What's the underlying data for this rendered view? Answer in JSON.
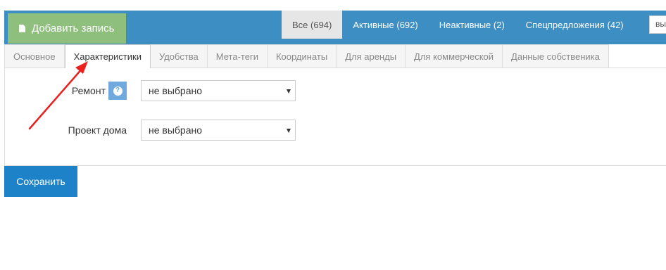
{
  "toolbar": {
    "add_label": "Добавить запись",
    "add_icon": "file-icon",
    "filters": [
      {
        "label": "Все (694)",
        "active": true
      },
      {
        "label": "Активные (692)",
        "active": false
      },
      {
        "label": "Неактивные (2)",
        "active": false
      },
      {
        "label": "Спецпредложения (42)",
        "active": false
      }
    ],
    "search_value": "вы"
  },
  "tabs": [
    {
      "label": "Основное",
      "active": false
    },
    {
      "label": "Характеристики",
      "active": true
    },
    {
      "label": "Удобства",
      "active": false
    },
    {
      "label": "Мета-теги",
      "active": false
    },
    {
      "label": "Координаты",
      "active": false
    },
    {
      "label": "Для аренды",
      "active": false
    },
    {
      "label": "Для коммерческой",
      "active": false
    },
    {
      "label": "Данные собственика",
      "active": false
    }
  ],
  "form": {
    "repair": {
      "label": "Ремонт",
      "value": "не выбрано",
      "help_icon": "question-icon"
    },
    "project": {
      "label": "Проект дома",
      "value": "не выбрано"
    }
  },
  "actions": {
    "save_label": "Сохранить"
  },
  "colors": {
    "topbar": "#3d8ec3",
    "add_button": "#8fbf7c",
    "save_button": "#1e82c8",
    "help": "#6fa9dd",
    "annotation_arrow": "#e8211d"
  }
}
